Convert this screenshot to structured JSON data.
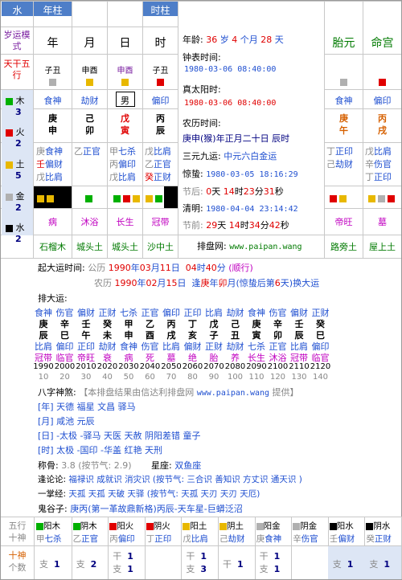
{
  "header": {
    "water_label": "水",
    "year_pillar": "年柱",
    "hour_pillar": "时柱",
    "cols": [
      "年",
      "月",
      "日",
      "时"
    ],
    "side_labels": {
      "luck_mode": "岁运模式",
      "stems_elements": "天干五行"
    }
  },
  "elements_side": [
    {
      "name": "木",
      "count": "3",
      "color": "#00b000"
    },
    {
      "name": "火",
      "count": "2",
      "color": "#e00000"
    },
    {
      "name": "土",
      "count": "5",
      "color": "#e8b800"
    },
    {
      "name": "金",
      "count": "2",
      "color": "#b0b0b0"
    },
    {
      "name": "水",
      "count": "2",
      "color": "#000000"
    }
  ],
  "pillars": {
    "stem_branch_names": [
      "子丑",
      "申酉",
      "申酉",
      "子丑"
    ],
    "ten_gods": [
      "食神",
      "劫财",
      "男",
      "偏印"
    ],
    "stems": [
      "庚",
      "己",
      "戊",
      "丙"
    ],
    "branches": [
      "申",
      "卯",
      "寅",
      "辰"
    ],
    "hidden": [
      [
        [
          "庚",
          "食神"
        ],
        [
          "壬",
          "偏财"
        ],
        [
          "戊",
          "比肩"
        ]
      ],
      [
        [
          "乙",
          "正官"
        ]
      ],
      [
        [
          "甲",
          "七杀"
        ],
        [
          "丙",
          "偏印"
        ],
        [
          "戊",
          "比肩"
        ]
      ],
      [
        [
          "戊",
          "比肩"
        ],
        [
          "乙",
          "正官"
        ],
        [
          "癸",
          "正财"
        ]
      ]
    ],
    "life_stage": [
      "病",
      "沐浴",
      "长生",
      "冠带"
    ],
    "nayin": [
      "石榴木",
      "城头土",
      "城头土",
      "沙中土"
    ]
  },
  "info": {
    "age_label": "年龄:",
    "age_years": "36",
    "age_text1": "岁",
    "age_months": "4",
    "age_text2": "个月",
    "age_days": "28",
    "age_text3": "天",
    "clock_label": "钟表时间:",
    "clock_value": "1980-03-06 08:40:00",
    "solar_label": "真太阳时:",
    "solar_value": "1980-03-06 08:40:00",
    "lunar_label": "农历时间:",
    "lunar_value": "庚申(猴)年正月二十日 辰时",
    "sanyuan_label": "三元九运:",
    "sanyuan_value": "中元六白金运",
    "jingzhe_label": "惊蛰:",
    "jingzhe_value": "1980-03-05 18:16:29",
    "jieqian_label": "节后:",
    "jieqian_d": "0",
    "jieqian_h": "14",
    "jieqian_m": "23",
    "jieqian_s": "31",
    "qingming_label": "清明:",
    "qingming_value": "1980-04-04 23:14:42",
    "jiejian_label": "节前:",
    "jiejian_d": "29",
    "jiejian_h": "14",
    "jiejian_m": "34",
    "jiejian_s": "42",
    "site_label": "排盘网:",
    "site_value": "www.paipan.wang"
  },
  "right_cols": {
    "headers": [
      "胎元",
      "命宫"
    ],
    "ten_gods": [
      "食神",
      "偏印"
    ],
    "stems": [
      "庚",
      "丙"
    ],
    "branches": [
      "午",
      "戌"
    ],
    "hidden": [
      [
        [
          "丁",
          "正印"
        ],
        [
          "己",
          "劫财"
        ]
      ],
      [
        [
          "戊",
          "比肩"
        ],
        [
          "辛",
          "伤官"
        ],
        [
          "丁",
          "正印"
        ]
      ]
    ],
    "life_stage": [
      "帝旺",
      "墓"
    ],
    "nayin": [
      "路旁土",
      "屋上土"
    ]
  },
  "dayun_intro": {
    "line1_label": "起大运时间:",
    "gongli": "公历",
    "gl_year": "1990",
    "gl_text1": "年",
    "gl_month": "03",
    "gl_text2": "月",
    "gl_day": "11",
    "gl_text3": "日",
    "gl_hour": "04",
    "gl_text4": "时",
    "gl_min": "40",
    "gl_text5": "分",
    "gl_tag": "(顺行)",
    "nongli": "农历",
    "nl_year": "1990",
    "nl_text1": "年",
    "nl_month": "02",
    "nl_text2": "月",
    "nl_day": "15",
    "nl_text3": "日",
    "nl_tail1": "逢",
    "nl_tail2": "庚",
    "nl_tail3": "年",
    "nl_tail4": "卯",
    "nl_tail5": "月(惊蛰后第",
    "nl_tail6": "6",
    "nl_tail7": "天)换大运"
  },
  "dayun": {
    "label": "排大运:",
    "gods": [
      "食神",
      "伤官",
      "偏财",
      "正财",
      "七杀",
      "正官",
      "偏印",
      "正印",
      "比肩",
      "劫财",
      "食神",
      "伤官",
      "偏财",
      "正财"
    ],
    "stems": [
      "庚",
      "辛",
      "壬",
      "癸",
      "甲",
      "乙",
      "丙",
      "丁",
      "戊",
      "己",
      "庚",
      "辛",
      "壬",
      "癸"
    ],
    "branches": [
      "辰",
      "巳",
      "午",
      "未",
      "申",
      "酉",
      "戌",
      "亥",
      "子",
      "丑",
      "寅",
      "卯",
      "辰",
      "巳"
    ],
    "branch_gods": [
      "比肩",
      "偏印",
      "正印",
      "劫财",
      "食神",
      "伤官",
      "比肩",
      "偏财",
      "正财",
      "劫财",
      "七杀",
      "正官",
      "比肩",
      "偏印"
    ],
    "stages": [
      "冠带",
      "临官",
      "帝旺",
      "衰",
      "病",
      "死",
      "墓",
      "绝",
      "胎",
      "养",
      "长生",
      "沐浴",
      "冠带",
      "临官"
    ],
    "years": [
      "1990",
      "2000",
      "2010",
      "2020",
      "2030",
      "2040",
      "2050",
      "2060",
      "2070",
      "2080",
      "2090",
      "2100",
      "2110",
      "2120"
    ],
    "ages": [
      "10",
      "20",
      "30",
      "40",
      "50",
      "60",
      "70",
      "80",
      "90",
      "100",
      "110",
      "120",
      "130",
      "140"
    ]
  },
  "shensha": {
    "label": "八字神煞:",
    "note": "【本排盘结果由信达利排盘网",
    "note_site": "www.paipan.wang",
    "note_end": "提供】",
    "year": "[年] 天德 福星 文昌 驿马",
    "month": "[月] 咸池 元辰",
    "day": "[日] -太极 -驿马 天医 天赦 阴阳差错 童子",
    "hour": "[时] 太极 -国印 -华盖 红艳 天刑"
  },
  "misc": {
    "weight_label": "称骨:",
    "weight_value": "3.8",
    "weight_extra": "(按节气: 2.9)",
    "star_label": "星座:",
    "star_value": "双鱼座",
    "dashi_label": "逢论论:",
    "dashi_value": "福禄识 成就识 消灾识 (按节气: 三合识 善知识 方丈识 通天识 )",
    "yizhang_label": "一掌经:",
    "yizhang_value": "天孤 天孤 天破 天驿 (按节气: 天孤 天刃 天刃 天厄)",
    "guigu_label": "鬼谷子:",
    "guigu_value": "庚丙(第一革故鼎新格)丙辰-天车星-巨蟒泛沼"
  },
  "bottom": {
    "left_top": "五行",
    "left_mid": "十神",
    "left_bottom_red": "十神",
    "left_bottom": "个数",
    "cells": [
      {
        "name": "阳木",
        "sq": "#00b000",
        "stem": "甲",
        "god": "七杀",
        "count_label": "支",
        "count": "1"
      },
      {
        "name": "阴木",
        "sq": "#00b000",
        "stem": "乙",
        "god": "正官",
        "count_label": "支",
        "count": "2"
      },
      {
        "name": "阳火",
        "sq": "#e00000",
        "stem": "丙",
        "god": "偏印",
        "count_label": "干\n支",
        "count": "1\n1"
      },
      {
        "name": "阴火",
        "sq": "#e00000",
        "stem": "丁",
        "god": "正印",
        "count_label": "",
        "count": ""
      },
      {
        "name": "阳土",
        "sq": "#e8b800",
        "stem": "戊",
        "god": "比肩",
        "count_label": "干\n支",
        "count": "1\n3"
      },
      {
        "name": "阴土",
        "sq": "#e8b800",
        "stem": "己",
        "god": "劫财",
        "count_label": "干",
        "count": "1"
      },
      {
        "name": "阳金",
        "sq": "#b0b0b0",
        "stem": "庚",
        "god": "食神",
        "count_label": "干\n支",
        "count": "1\n1"
      },
      {
        "name": "阴金",
        "sq": "#b0b0b0",
        "stem": "辛",
        "god": "伤官",
        "count_label": "",
        "count": ""
      },
      {
        "name": "阳水",
        "sq": "#000000",
        "stem": "壬",
        "god": "偏财",
        "count_label": "支",
        "count": "1"
      },
      {
        "name": "阴水",
        "sq": "#000000",
        "stem": "癸",
        "god": "正财",
        "count_label": "支",
        "count": "1"
      }
    ]
  }
}
